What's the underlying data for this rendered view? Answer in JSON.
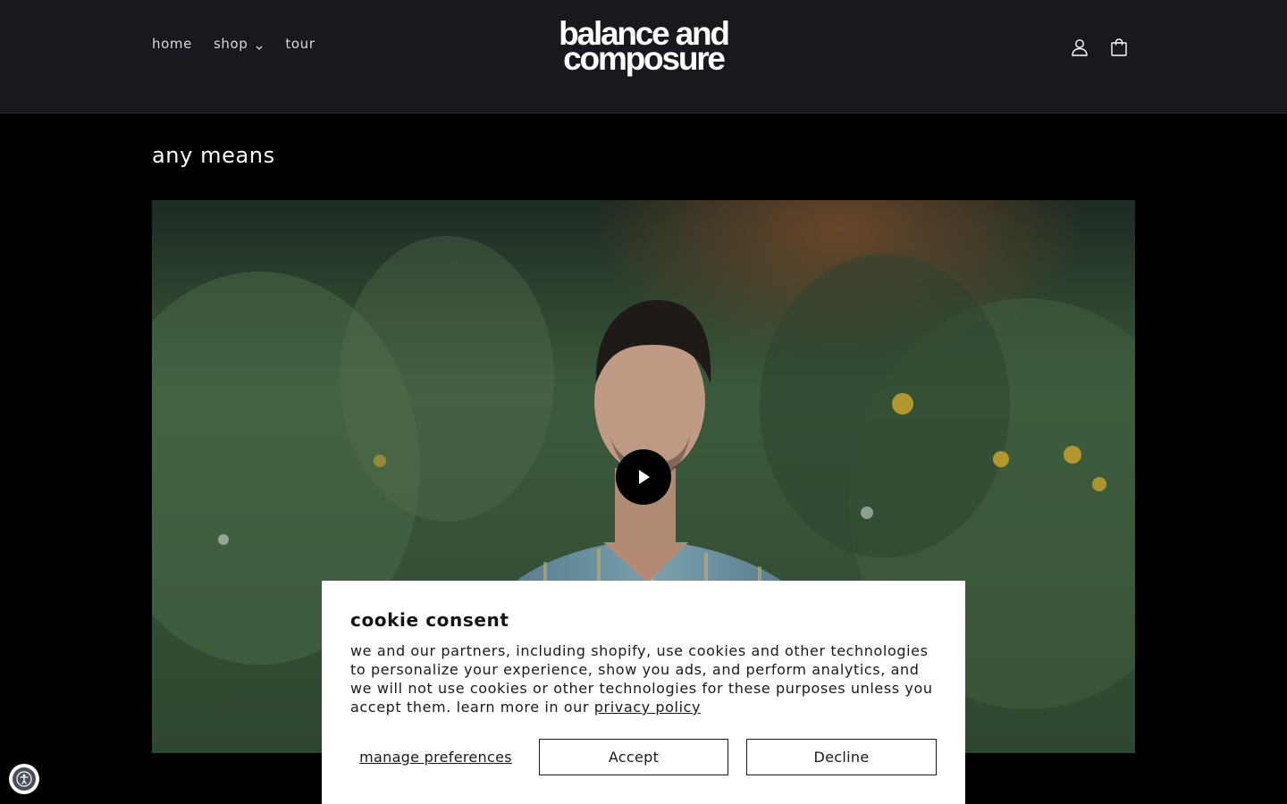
{
  "header": {
    "nav": [
      {
        "label": "home"
      },
      {
        "label": "shop",
        "has_dropdown": true
      },
      {
        "label": "tour"
      }
    ],
    "logo_line1": "balance and",
    "logo_line2": "composure",
    "icons": [
      "account-icon",
      "cart-icon"
    ]
  },
  "main": {
    "title": "any means",
    "video": {
      "play_icon": "play-icon"
    }
  },
  "cookie_banner": {
    "title": "cookie consent",
    "body": "we and our partners, including shopify, use cookies and other technologies to personalize your experience, show you ads, and perform analytics, and we will not use cookies or other technologies for these purposes unless you accept them. learn more in our ",
    "privacy_link": "privacy policy",
    "manage_label": "manage preferences",
    "accept_label": "Accept",
    "decline_label": "Decline"
  },
  "accessibility": {
    "icon": "accessibility-icon"
  },
  "colors": {
    "header_bg": "#17191e",
    "page_bg": "#000000",
    "banner_bg": "#ffffff",
    "text_dark": "#121212"
  }
}
